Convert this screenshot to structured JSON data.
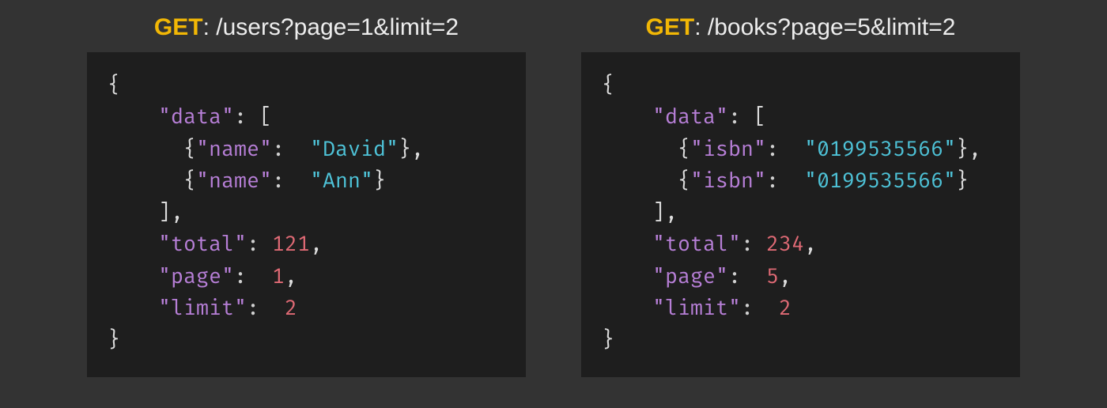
{
  "examples": [
    {
      "header": {
        "method": "GET",
        "sep": ": ",
        "path": "/users?page=1&limit=2"
      },
      "response": {
        "data_key": "data",
        "item_key": "name",
        "items": [
          "David",
          "Ann"
        ],
        "total_key": "total",
        "total": 121,
        "page_key": "page",
        "page": 1,
        "limit_key": "limit",
        "limit": 2
      }
    },
    {
      "header": {
        "method": "GET",
        "sep": ": ",
        "path": "/books?page=5&limit=2"
      },
      "response": {
        "data_key": "data",
        "item_key": "isbn",
        "items": [
          "0199535566",
          "0199535566"
        ],
        "total_key": "total",
        "total": 234,
        "page_key": "page",
        "page": 5,
        "limit_key": "limit",
        "limit": 2
      }
    }
  ]
}
